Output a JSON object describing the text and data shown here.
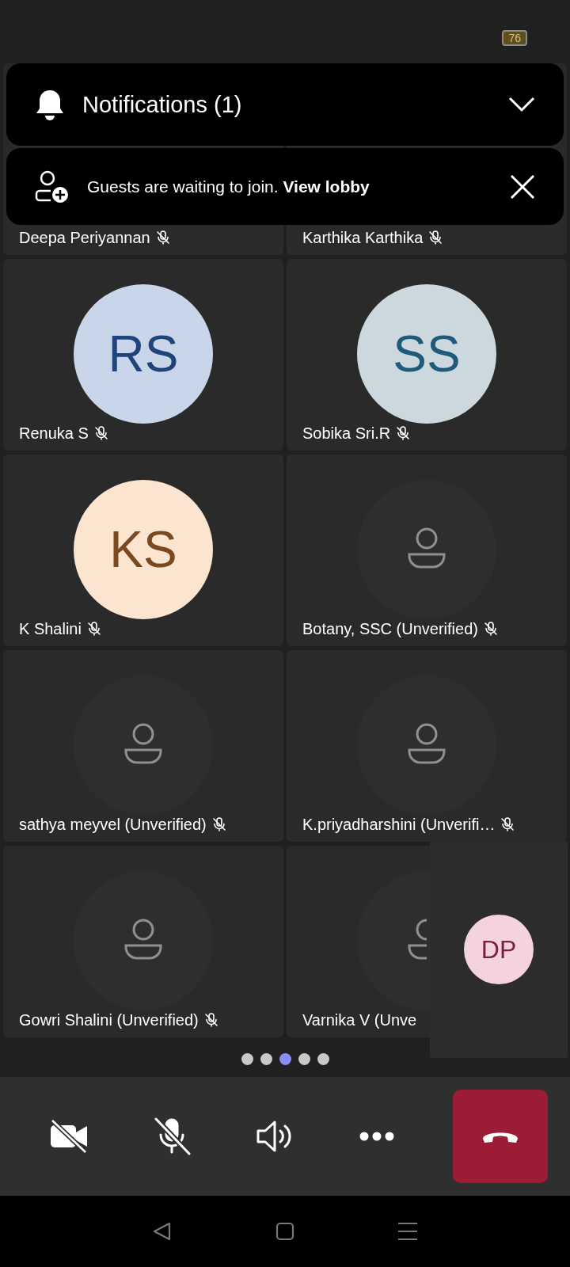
{
  "status_bar": {
    "battery": "76"
  },
  "notifications": {
    "title": "Notifications (1)",
    "banner_text": "Guests are waiting to join.",
    "banner_link": "View lobby"
  },
  "participants": [
    {
      "name": "Deepa Periyannan",
      "muted": true
    },
    {
      "name": "Karthika Karthika",
      "muted": true
    },
    {
      "name": "Renuka S",
      "muted": true,
      "kind": "initials",
      "initials": "RS",
      "color": "#c9d6ea"
    },
    {
      "name": "Sobika Sri.R",
      "muted": true,
      "kind": "initials",
      "initials": "SS",
      "color": "#cdd8de"
    },
    {
      "name": "K Shalini",
      "muted": true,
      "kind": "initials",
      "initials": "KS",
      "color": "#fbe4d0"
    },
    {
      "name": "Botany, SSC (Unverified)",
      "muted": true,
      "kind": "placeholder"
    },
    {
      "name": "sathya meyvel (Unverified)",
      "muted": true,
      "kind": "placeholder"
    },
    {
      "name": "K.priyadharshini (Unverifi…",
      "muted": true,
      "kind": "placeholder"
    },
    {
      "name": "Gowri Shalini (Unverified)",
      "muted": true,
      "kind": "placeholder"
    },
    {
      "name": "Varnika V (Unve",
      "muted": false,
      "kind": "placeholder"
    }
  ],
  "pages": [
    {
      "selected": false
    },
    {
      "selected": false
    },
    {
      "selected": true
    },
    {
      "selected": false
    },
    {
      "selected": false
    }
  ],
  "self_view": {
    "initials": "DP",
    "color": "#f4d3df"
  },
  "controls": [
    {
      "kind": "camera",
      "off": true
    },
    {
      "kind": "mic",
      "off": true
    },
    {
      "kind": "speaker"
    },
    {
      "kind": "more"
    },
    {
      "kind": "hangup"
    }
  ]
}
